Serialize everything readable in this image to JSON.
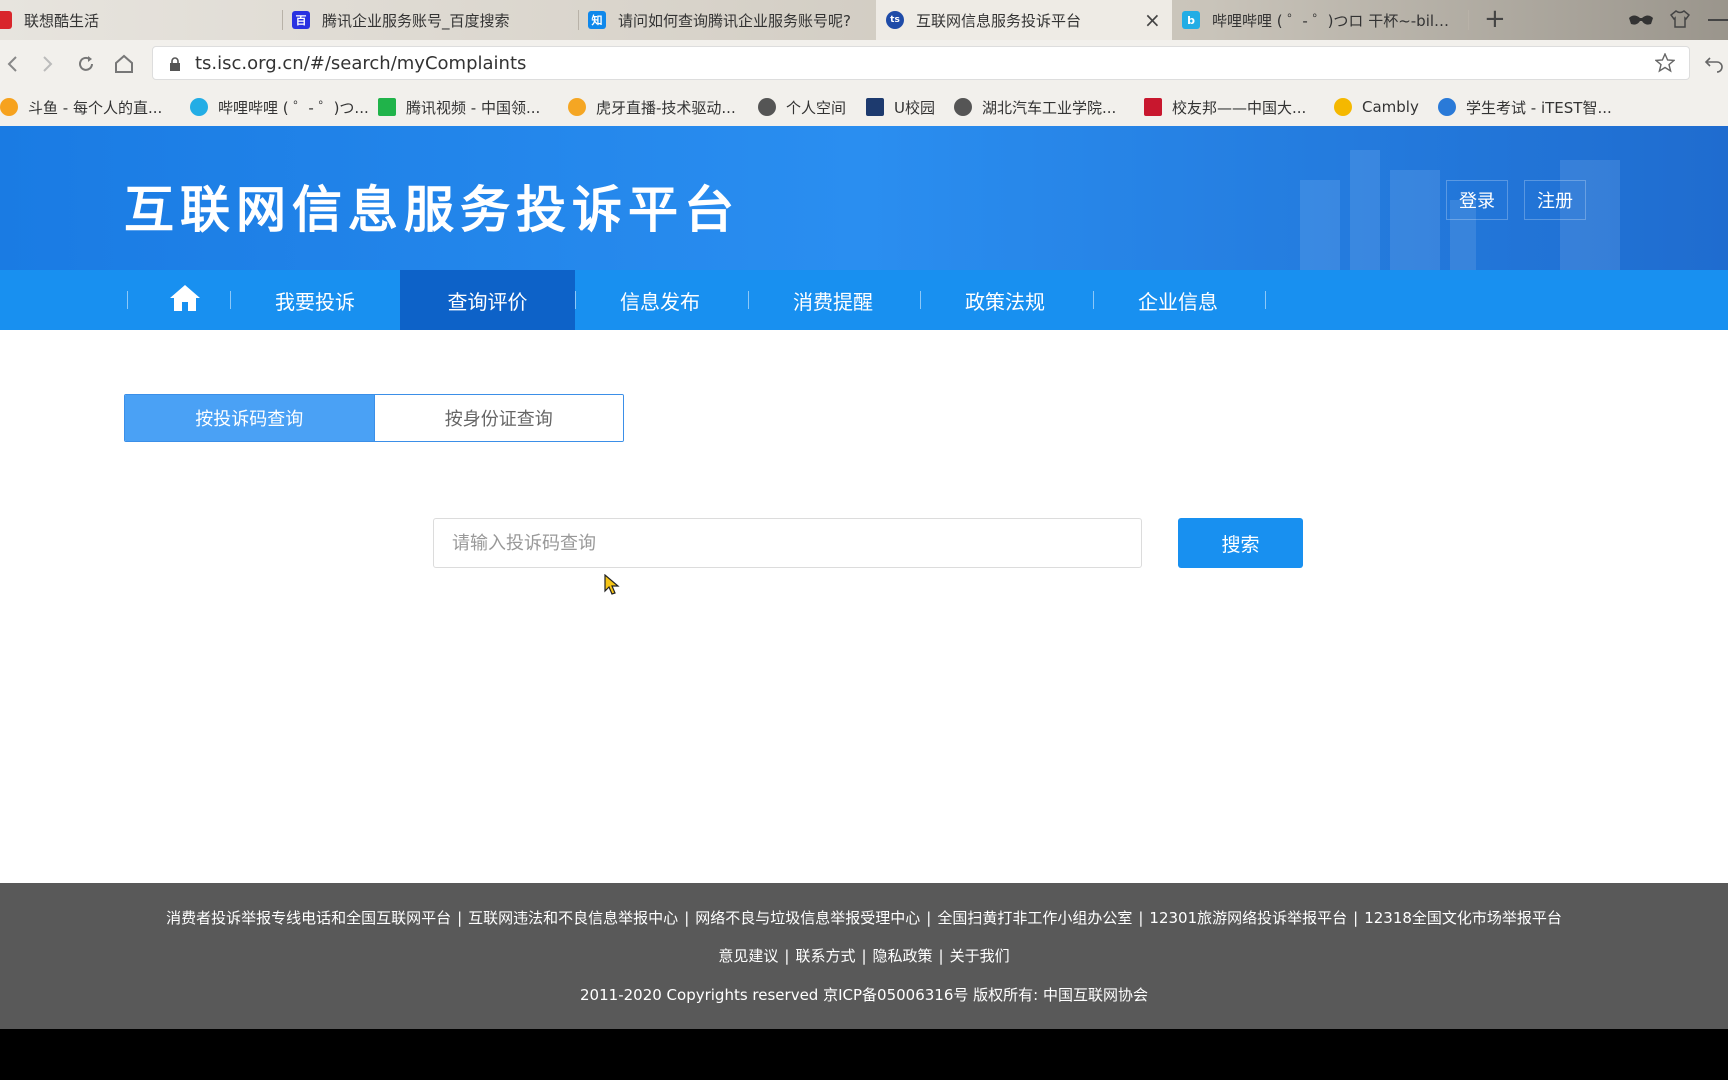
{
  "browser": {
    "tabs": [
      {
        "label": "联想酷生活",
        "icon": "lenovo-icon",
        "color": "#d9262b",
        "glyph": "联"
      },
      {
        "label": "腾讯企业服务账号_百度搜索",
        "icon": "baidu-icon",
        "color": "#2932e1",
        "glyph": "百"
      },
      {
        "label": "请问如何查询腾讯企业服务账号呢?",
        "icon": "zhihu-icon",
        "color": "#0f88eb",
        "glyph": "知"
      },
      {
        "label": "互联网信息服务投诉平台",
        "icon": "ts-icon",
        "color": "#1e4ba8",
        "glyph": "ts"
      },
      {
        "label": "哔哩哔哩 ( ゜- ゜)つロ 干杯~-bilibili",
        "icon": "bilibili-icon",
        "color": "#23ade5",
        "glyph": "b"
      }
    ],
    "close_tab_glyph": "×",
    "new_tab_glyph": "+",
    "url": "ts.isc.org.cn/#/search/myComplaints",
    "bookmarks": [
      {
        "label": "斗鱼 - 每个人的直...",
        "color": "#f6a21e"
      },
      {
        "label": "哔哩哔哩 ( ゜- ゜)つ...",
        "color": "#23ade5"
      },
      {
        "label": "腾讯视频 - 中国领...",
        "color": "#20b34a"
      },
      {
        "label": "虎牙直播-技术驱动...",
        "color": "#f5a623"
      },
      {
        "label": "个人空间",
        "color": "#555555"
      },
      {
        "label": "U校园",
        "color": "#1d3a6e"
      },
      {
        "label": "湖北汽车工业学院...",
        "color": "#555555"
      },
      {
        "label": "校友邦——中国大...",
        "color": "#c8172e"
      },
      {
        "label": "Cambly",
        "color": "#f5b800"
      },
      {
        "label": "学生考试 - iTEST智...",
        "color": "#2a7ad8"
      }
    ]
  },
  "site": {
    "title": "互联网信息服务投诉平台",
    "login": "登录",
    "register": "注册",
    "nav": [
      "我要投诉",
      "查询评价",
      "信息发布",
      "消费提醒",
      "政策法规",
      "企业信息"
    ],
    "nav_active": "查询评价"
  },
  "query": {
    "tab_code": "按投诉码查询",
    "tab_id": "按身份证查询",
    "placeholder": "请输入投诉码查询",
    "search_button": "搜索"
  },
  "footer": {
    "links_row1": [
      "消费者投诉举报专线电话和全国互联网平台",
      "互联网违法和不良信息举报中心",
      "网络不良与垃圾信息举报受理中心",
      "全国扫黄打非工作小组办公室",
      "12301旅游网络投诉举报平台",
      "12318全国文化市场举报平台"
    ],
    "links_row2": [
      "意见建议",
      "联系方式",
      "隐私政策",
      "关于我们"
    ],
    "copyright": "2011-2020 Copyrights reserved 京ICP备05006316号 版权所有: 中国互联网协会",
    "separator": "|"
  }
}
